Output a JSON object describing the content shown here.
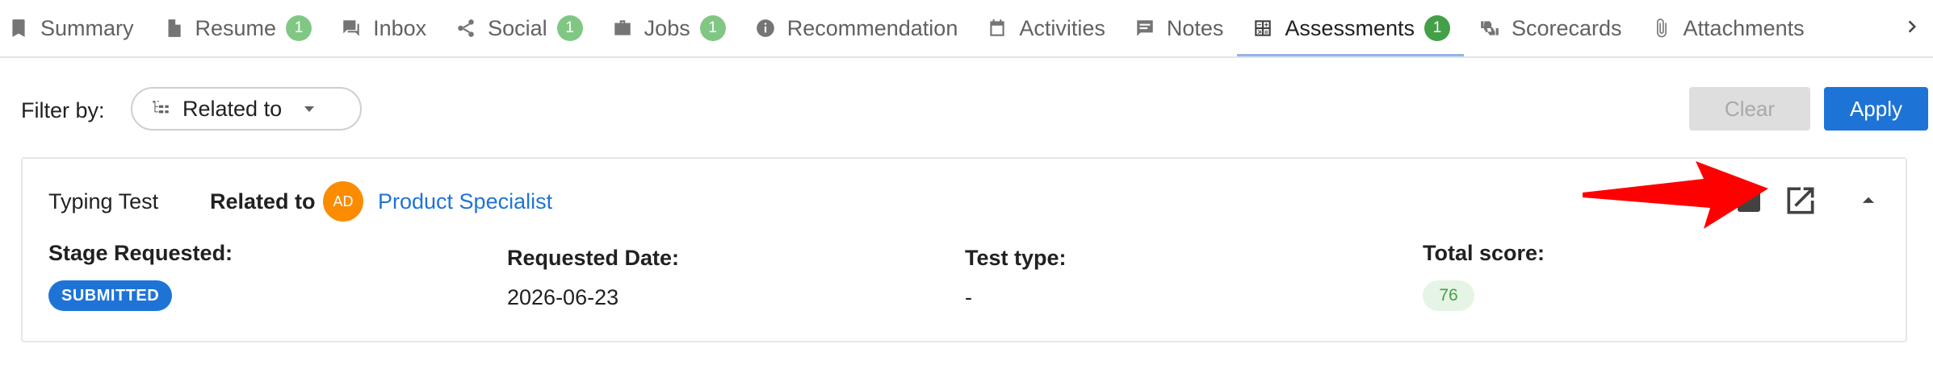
{
  "tabs": [
    {
      "label": "Summary",
      "icon": "bookmark-icon"
    },
    {
      "label": "Resume",
      "icon": "document-icon",
      "badge": "1"
    },
    {
      "label": "Inbox",
      "icon": "chat-icon"
    },
    {
      "label": "Social",
      "icon": "share-icon",
      "badge": "1"
    },
    {
      "label": "Jobs",
      "icon": "briefcase-icon",
      "badge": "1"
    },
    {
      "label": "Recommendation",
      "icon": "info-icon"
    },
    {
      "label": "Activities",
      "icon": "calendar-icon"
    },
    {
      "label": "Notes",
      "icon": "note-icon"
    },
    {
      "label": "Assessments",
      "icon": "calculator-icon",
      "badge": "1",
      "active": true
    },
    {
      "label": "Scorecards",
      "icon": "thumbs-icon"
    },
    {
      "label": "Attachments",
      "icon": "paperclip-icon"
    }
  ],
  "filter": {
    "label": "Filter by:",
    "selected": "Related to",
    "clear_label": "Clear",
    "apply_label": "Apply"
  },
  "assessment": {
    "title": "Typing Test",
    "related_label": "Related to",
    "avatar_initials": "AD",
    "related_link": "Product Specialist",
    "fields": {
      "stage": {
        "label": "Stage Requested:",
        "value": "SUBMITTED"
      },
      "date": {
        "label": "Requested Date:",
        "value": "2026-06-23"
      },
      "test_type": {
        "label": "Test type:",
        "value": "-"
      },
      "score": {
        "label": "Total score:",
        "value": "76"
      }
    }
  },
  "colors": {
    "accent": "#1e74d6",
    "badge_green": "#43a047",
    "avatar_orange": "#fb8c00",
    "annotation_red": "#ff0000"
  }
}
